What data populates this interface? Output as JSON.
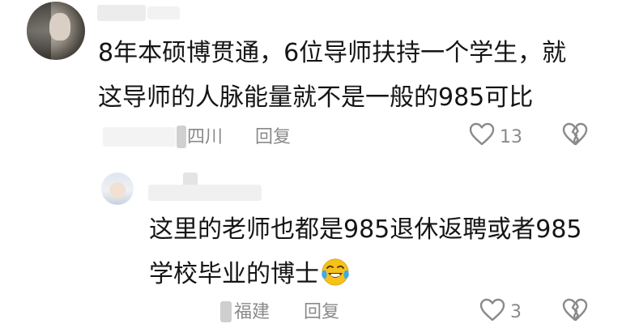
{
  "comments": [
    {
      "line1": "8年本硕博贯通，6位导师扶持一个学生，就",
      "line2": "这导师的人脉能量就不是一般的985可比",
      "location": "四川",
      "reply_label": "回复",
      "likes": "13",
      "icons": [
        "heart-icon",
        "broken-heart-icon"
      ]
    },
    {
      "line1": "这里的老师也都是985退休返聘或者985",
      "line2": "学校毕业的博士",
      "emoji": "laughing-crying-emoji",
      "location": "福建",
      "reply_label": "回复",
      "likes": "3",
      "icons": [
        "heart-icon",
        "broken-heart-icon"
      ]
    }
  ]
}
